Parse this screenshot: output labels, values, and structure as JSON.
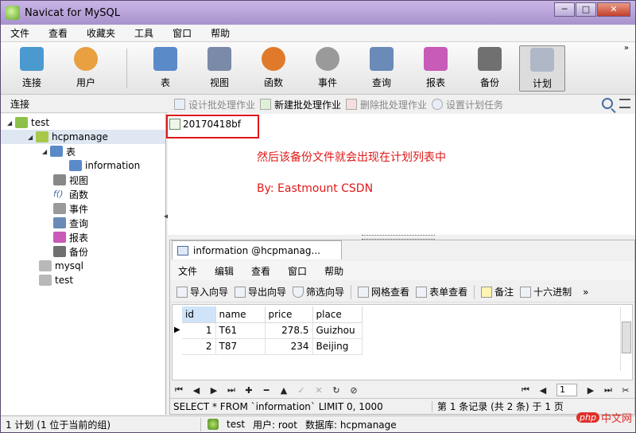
{
  "window": {
    "title": "Navicat for MySQL"
  },
  "menu": [
    "文件",
    "查看",
    "收藏夹",
    "工具",
    "窗口",
    "帮助"
  ],
  "toolbar": {
    "buttons": [
      {
        "label": "连接",
        "icon": "connection-icon",
        "color": "#4a9ad0"
      },
      {
        "label": "用户",
        "icon": "user-icon",
        "color": "#e8a040"
      },
      {
        "label": "表",
        "icon": "table-icon",
        "color": "#5a8ac8"
      },
      {
        "label": "视图",
        "icon": "view-icon",
        "color": "#7a8aa8"
      },
      {
        "label": "函数",
        "icon": "function-icon",
        "color": "#e07a2a"
      },
      {
        "label": "事件",
        "icon": "event-icon",
        "color": "#9a9a9a"
      },
      {
        "label": "查询",
        "icon": "query-icon",
        "color": "#6a8ab8"
      },
      {
        "label": "报表",
        "icon": "report-icon",
        "color": "#c85ab8"
      },
      {
        "label": "备份",
        "icon": "backup-icon",
        "color": "#707070"
      },
      {
        "label": "计划",
        "icon": "schedule-icon",
        "color": "#b0b8c8"
      }
    ]
  },
  "connection_label": "连接",
  "object_toolbar": {
    "design": "设计批处理作业",
    "new": "新建批处理作业",
    "delete": "删除批处理作业",
    "schedule": "设置计划任务"
  },
  "tree": {
    "conn": "test",
    "db": "hcpmanage",
    "tables": "表",
    "table_info": "information",
    "views": "视图",
    "functions": "函数",
    "events": "事件",
    "queries": "查询",
    "reports": "报表",
    "backups": "备份",
    "mysql": "mysql",
    "test": "test"
  },
  "object_list": {
    "item": "20170418bf",
    "note1": "然后该备份文件就会出现在计划列表中",
    "note2": "By: Eastmount CSDN",
    "highlight_color": "#e01818"
  },
  "subwindow": {
    "tab": "information @hcpmanag...",
    "menu": [
      "文件",
      "编辑",
      "查看",
      "窗口",
      "帮助"
    ],
    "tools": {
      "import": "导入向导",
      "export": "导出向导",
      "filter": "筛选向导",
      "grid": "网格查看",
      "form": "表单查看",
      "memo": "备注",
      "hex": "十六进制"
    },
    "columns": [
      "id",
      "name",
      "price",
      "place"
    ],
    "rows": [
      [
        "1",
        "T61",
        "278.5",
        "Guizhou"
      ],
      [
        "2",
        "T87",
        "234",
        "Beijing"
      ]
    ],
    "page": "1",
    "sql": "SELECT * FROM `information` LIMIT 0, 1000",
    "records": "第 1 条记录 (共 2 条) 于 1 页"
  },
  "status": {
    "left": "1 计划 (1 位于当前的组)",
    "conn": "test",
    "user": "用户: root",
    "db": "数据库: hcpmanage"
  },
  "watermark": {
    "php": "php",
    "cn": "中文网"
  }
}
